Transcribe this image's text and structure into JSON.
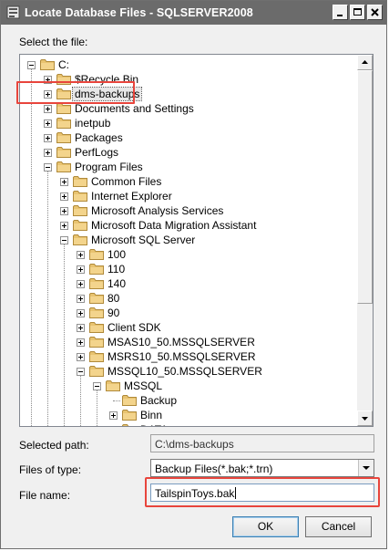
{
  "window": {
    "title": "Locate Database Files - SQLSERVER2008"
  },
  "labels": {
    "select_file": "Select the file:",
    "selected_path": "Selected path:",
    "files_of_type": "Files of type:",
    "file_name": "File name:"
  },
  "tree": {
    "items": [
      {
        "label": "C:",
        "expanded": true
      },
      {
        "label": "$Recycle.Bin"
      },
      {
        "label": "dms-backups",
        "selected": true
      },
      {
        "label": "Documents and Settings"
      },
      {
        "label": "inetpub"
      },
      {
        "label": "Packages"
      },
      {
        "label": "PerfLogs"
      },
      {
        "label": "Program Files",
        "expanded": true
      },
      {
        "label": "Common Files"
      },
      {
        "label": "Internet Explorer"
      },
      {
        "label": "Microsoft Analysis Services"
      },
      {
        "label": "Microsoft Data Migration Assistant"
      },
      {
        "label": "Microsoft SQL Server",
        "expanded": true
      },
      {
        "label": "100"
      },
      {
        "label": "110"
      },
      {
        "label": "140"
      },
      {
        "label": "80"
      },
      {
        "label": "90"
      },
      {
        "label": "Client SDK"
      },
      {
        "label": "MSAS10_50.MSSQLSERVER"
      },
      {
        "label": "MSRS10_50.MSSQLSERVER"
      },
      {
        "label": "MSSQL10_50.MSSQLSERVER",
        "expanded": true
      },
      {
        "label": "MSSQL",
        "expanded": true
      },
      {
        "label": "Backup"
      },
      {
        "label": "Binn"
      },
      {
        "label": "DATA"
      }
    ]
  },
  "fields": {
    "selected_path_value": "C:\\dms-backups",
    "files_of_type_value": "Backup Files(*.bak;*.trn)",
    "file_name_value": "TailspinToys.bak"
  },
  "buttons": {
    "ok": "OK",
    "cancel": "Cancel"
  },
  "colors": {
    "titlebar": "#6b6b6b",
    "highlight": "#e8453c",
    "folder": "#e8c370"
  }
}
